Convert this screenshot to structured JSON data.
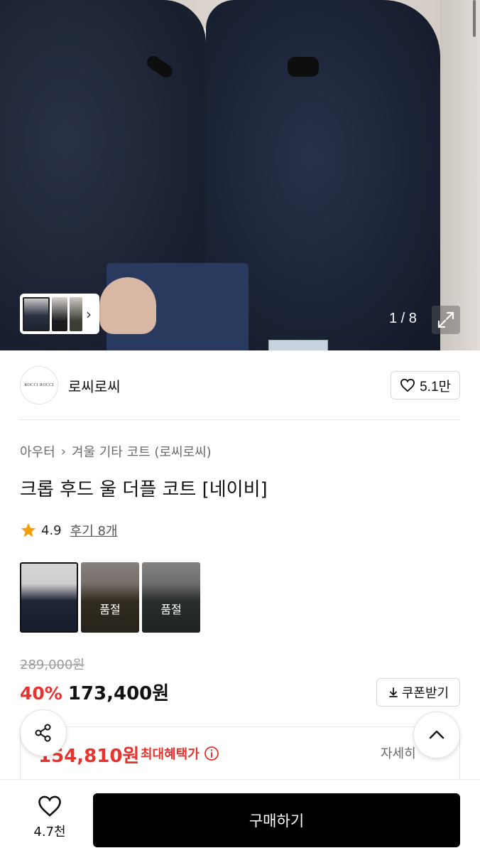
{
  "gallery": {
    "counter": "1 / 8",
    "thumb_arrow": "›",
    "expand_icon": "expand-icon"
  },
  "brand": {
    "logo_text": "ROCCI ROCCI",
    "name": "로씨로씨",
    "like_count": "5.1만"
  },
  "breadcrumb": {
    "level1": "아우터",
    "separator": "›",
    "level2": "겨울 기타 코트 (로씨로씨)"
  },
  "product": {
    "title": "크롭 후드 울 더플 코트 [네이비]",
    "rating": "4.9",
    "review_link": "후기 8개"
  },
  "options": [
    {
      "name": "navy",
      "soldout_label": ""
    },
    {
      "name": "khaki",
      "soldout_label": "품절"
    },
    {
      "name": "charcoal",
      "soldout_label": "품절"
    }
  ],
  "pricing": {
    "original_price": "289,000원",
    "discount": "40%",
    "sale_price": "173,400원",
    "coupon_button": "쿠폰받기",
    "benefit_price": "154,810원",
    "benefit_label": "최대혜택가",
    "detail_link": "자세히"
  },
  "bottom_bar": {
    "wish_count": "4.7천",
    "buy_button": "구매하기"
  },
  "colors": {
    "accent_red": "#e8322e",
    "buy_button_bg": "#000000",
    "star": "#f59e0b"
  }
}
